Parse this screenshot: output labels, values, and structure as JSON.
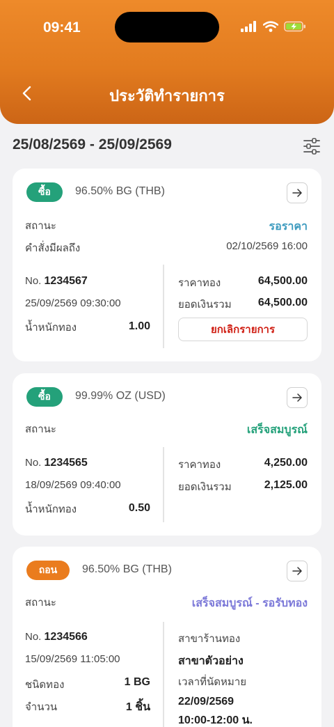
{
  "status_bar": {
    "time": "09:41"
  },
  "header": {
    "title": "ประวัติทำรายการ"
  },
  "date_range": "25/08/2569 - 25/09/2569",
  "icons": {
    "back": "chevron-left-icon",
    "filter": "filter-sliders-icon",
    "open": "arrow-right-icon"
  },
  "colors": {
    "header_orange": "#e27b1f",
    "buy_badge": "#24a17a",
    "withdraw_badge": "#ea7c1e",
    "status_waiting": "#3d9bbf",
    "status_complete": "#24a17a",
    "status_pickup": "#7b78d8",
    "cancel_red": "#d01f14"
  },
  "cards": [
    {
      "badge": "ซื้อ",
      "product": "96.50% BG (THB)",
      "status_label": "สถานะ",
      "status_value": "รอราคา",
      "effective_label": "คำสั่งมีผลถึง",
      "effective_value": "02/10/2569 16:00",
      "order_prefix": "No.",
      "order_no": "1234567",
      "datetime": "25/09/2569 09:30:00",
      "weight_label": "น้ำหนักทอง",
      "weight_value": "1.00",
      "price_label": "ราคาทอง",
      "price_value": "64,500.00",
      "total_label": "ยอดเงินรวม",
      "total_value": "64,500.00",
      "cancel_label": "ยกเลิกรายการ"
    },
    {
      "badge": "ซื้อ",
      "product": "99.99% OZ (USD)",
      "status_label": "สถานะ",
      "status_value": "เสร็จสมบูรณ์",
      "order_prefix": "No.",
      "order_no": "1234565",
      "datetime": "18/09/2569 09:40:00",
      "weight_label": "น้ำหนักทอง",
      "weight_value": "0.50",
      "price_label": "ราคาทอง",
      "price_value": "4,250.00",
      "total_label": "ยอดเงินรวม",
      "total_value": "2,125.00"
    },
    {
      "badge": "ถอน",
      "product": "96.50% BG (THB)",
      "status_label": "สถานะ",
      "status_value": "เสร็จสมบูรณ์ - รอรับทอง",
      "order_prefix": "No.",
      "order_no": "1234566",
      "datetime": "15/09/2569 11:05:00",
      "type_label": "ชนิดทอง",
      "type_value": "1 BG",
      "qty_label": "จำนวน",
      "qty_value": "1 ชิ้น",
      "branch_label": "สาขาร้านทอง",
      "branch_value": "สาขาตัวอย่าง",
      "appt_label": "เวลาที่นัดหมาย",
      "appt_date": "22/09/2569",
      "appt_time": "10:00-12:00 น."
    }
  ]
}
